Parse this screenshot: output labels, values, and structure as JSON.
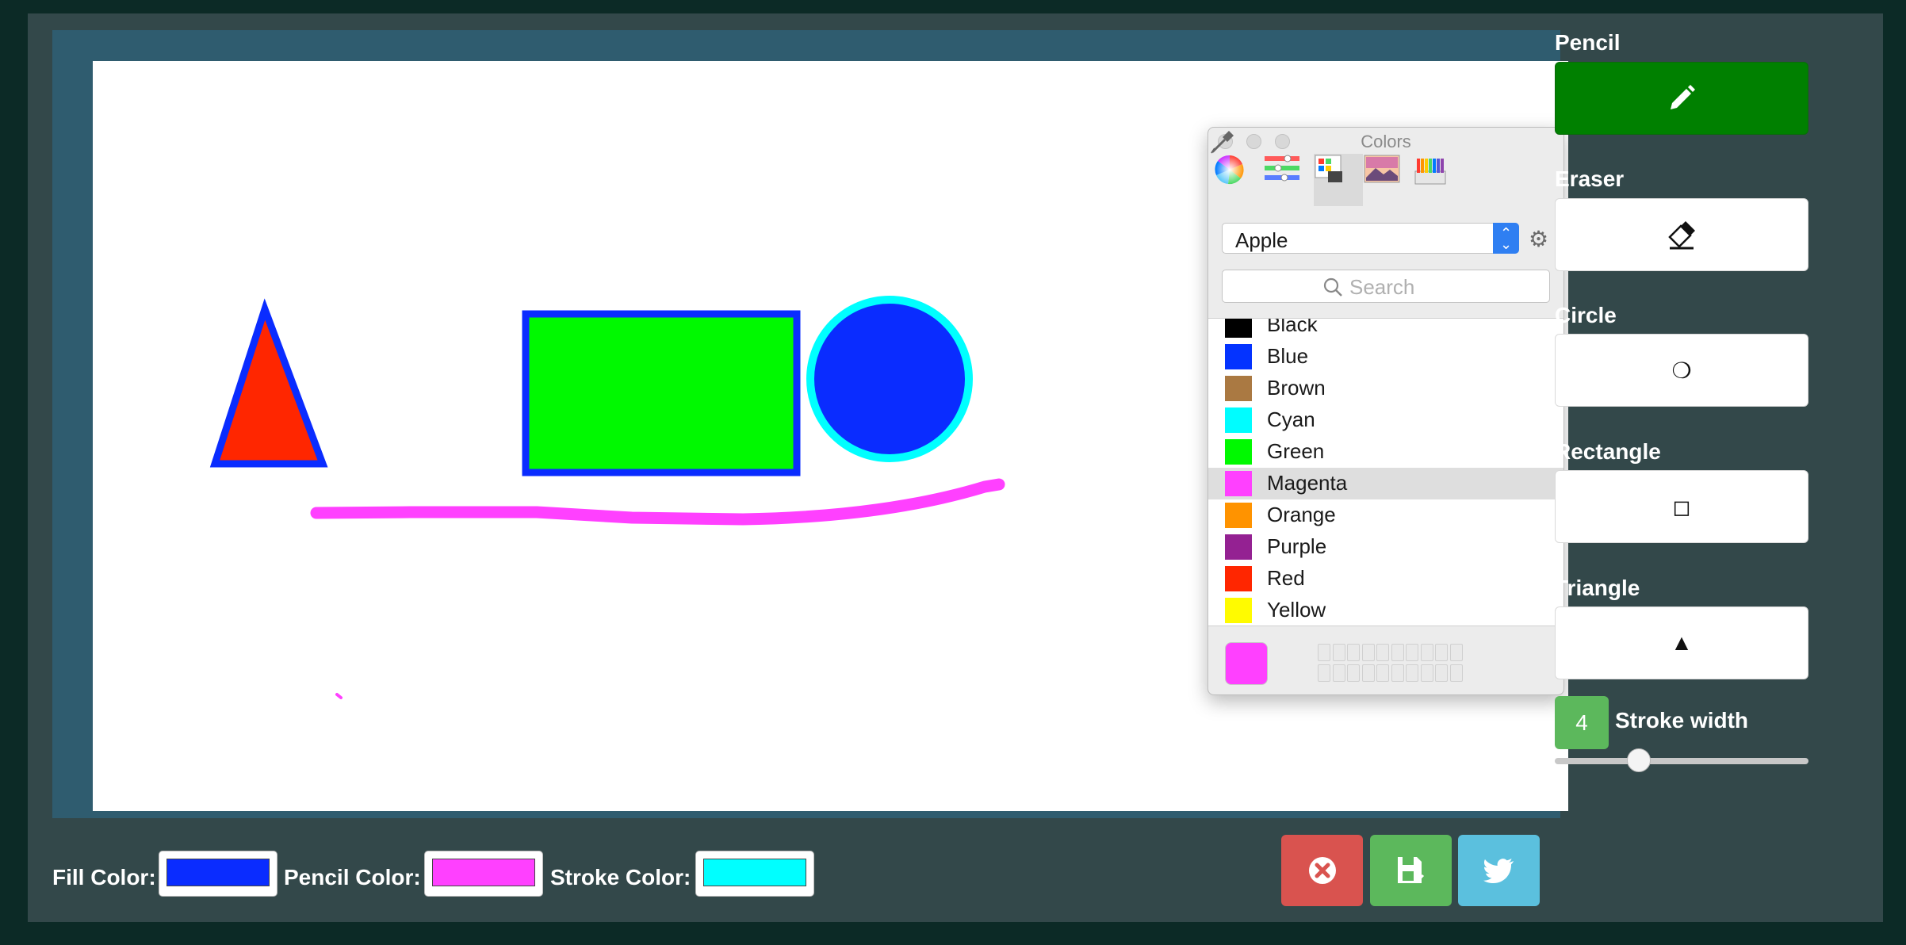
{
  "tools": {
    "pencil": {
      "label": "Pencil",
      "active": true
    },
    "eraser": {
      "label": "Eraser"
    },
    "circle": {
      "label": "Circle",
      "glyph": "❍"
    },
    "rectangle": {
      "label": "Rectangle",
      "glyph": "◻"
    },
    "triangle": {
      "label": "Triangle",
      "glyph": "▲"
    }
  },
  "stroke": {
    "value": "4",
    "label": "Stroke width",
    "slider_fraction": 0.33
  },
  "bottom": {
    "fill_label": "Fill Color:",
    "fill_color": "#0a2cff",
    "pencil_label": "Pencil Color:",
    "pencil_color": "#ff40ff",
    "stroke_label": "Stroke Color:",
    "stroke_color": "#00ffff"
  },
  "actions": [
    {
      "name": "clear-button",
      "icon": "times-circle-icon",
      "color": "#d9534f"
    },
    {
      "name": "save-button",
      "icon": "save-icon",
      "color": "#5cb85c"
    },
    {
      "name": "twitter-button",
      "icon": "twitter-icon",
      "color": "#5bc0de"
    }
  ],
  "colors_panel": {
    "title": "Colors",
    "modes": [
      "color-wheel-icon",
      "sliders-icon",
      "palettes-icon",
      "image-palettes-icon",
      "crayons-icon"
    ],
    "active_mode": 2,
    "palette": "Apple",
    "search_placeholder": "Search",
    "selected": "Magenta",
    "current_color": "#ff40ff",
    "items": [
      {
        "name": "Black",
        "color": "#000000"
      },
      {
        "name": "Blue",
        "color": "#0433ff"
      },
      {
        "name": "Brown",
        "color": "#aa7942"
      },
      {
        "name": "Cyan",
        "color": "#00fdff"
      },
      {
        "name": "Green",
        "color": "#00f900"
      },
      {
        "name": "Magenta",
        "color": "#ff40ff"
      },
      {
        "name": "Orange",
        "color": "#ff9300"
      },
      {
        "name": "Purple",
        "color": "#942192"
      },
      {
        "name": "Red",
        "color": "#ff2600"
      },
      {
        "name": "Yellow",
        "color": "#fffb00"
      }
    ]
  },
  "drawing": {
    "triangle": {
      "fill": "#ff2600",
      "stroke": "#0a2cff"
    },
    "rectangle": {
      "fill": "#00f900",
      "stroke": "#0a2cff"
    },
    "circle": {
      "fill": "#0a2cff",
      "stroke": "#00ffff"
    },
    "pencil_line": {
      "color": "#ff40ff"
    }
  }
}
